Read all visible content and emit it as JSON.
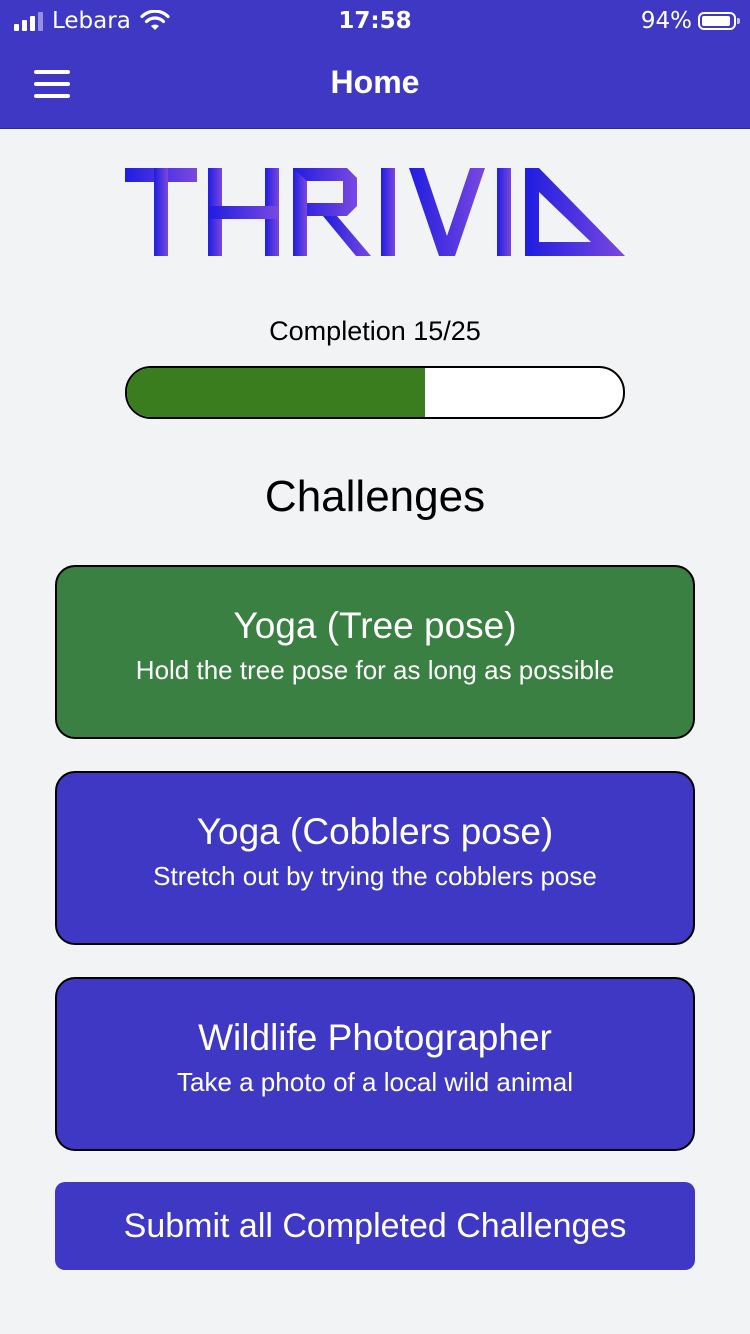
{
  "status_bar": {
    "carrier": "Lebara",
    "time": "17:58",
    "battery": "94%",
    "battery_level": 0.94,
    "signal_bars": 3
  },
  "nav": {
    "title": "Home",
    "menu_icon": "hamburger-menu-icon"
  },
  "logo": {
    "text": "THRIVIA",
    "gradient": [
      "#1f1de0",
      "#7a48e0"
    ]
  },
  "progress": {
    "label": "Completion 15/25",
    "completed": 15,
    "total": 25,
    "fraction": 0.6
  },
  "challenges": {
    "heading": "Challenges",
    "items": [
      {
        "title": "Yoga (Tree pose)",
        "description": "Hold the tree pose for as long as possible",
        "completed": true,
        "color": "#3b8043"
      },
      {
        "title": "Yoga (Cobblers pose)",
        "description": "Stretch out by trying the cobblers pose",
        "completed": false,
        "color": "#3f38c4"
      },
      {
        "title": "Wildlife Photographer",
        "description": "Take a photo of a local wild animal",
        "completed": false,
        "color": "#3f38c4"
      }
    ]
  },
  "submit": {
    "label": "Submit all Completed Challenges"
  },
  "colors": {
    "primary": "#3f38c4",
    "success": "#3b8043",
    "progress_fill": "#3a7d1e",
    "background": "#f2f3f5"
  }
}
